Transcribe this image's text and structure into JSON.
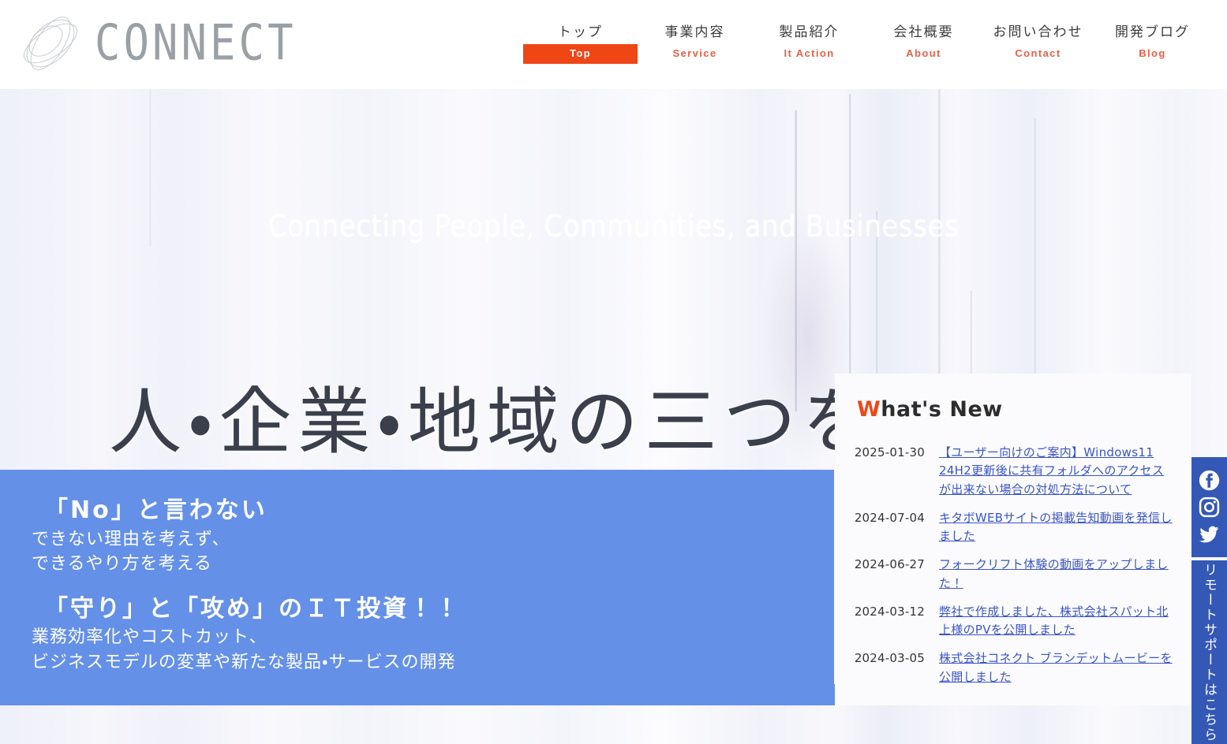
{
  "brand": {
    "name": "CONNECT",
    "logo_icon": "orbital-ellipses-logo-icon"
  },
  "nav": {
    "items": [
      {
        "ja": "トップ",
        "en": "Top",
        "active": true
      },
      {
        "ja": "事業内容",
        "en": "Service",
        "active": false
      },
      {
        "ja": "製品紹介",
        "en": "It Action",
        "active": false
      },
      {
        "ja": "会社概要",
        "en": "About",
        "active": false
      },
      {
        "ja": "お問い合わせ",
        "en": "Contact",
        "active": false
      },
      {
        "ja": "開発ブログ",
        "en": "Blog",
        "active": false
      }
    ]
  },
  "hero": {
    "tagline": "Connecting People, Communities, and Businesses",
    "headline": "人・企業・地域の三つをツナグ"
  },
  "promo": {
    "block1": {
      "heading": "「No」と言わない",
      "line1": "できない理由を考えず、",
      "line2": "できるやり方を考える"
    },
    "block2": {
      "heading": "「守り」と「攻め」のＩＴ投資！！",
      "line1": "業務効率化やコストカット、",
      "line2": "ビジネスモデルの変革や新たな製品・サービスの開発"
    }
  },
  "news": {
    "title_first_letter": "W",
    "title_rest": "hat's New",
    "items": [
      {
        "date": "2025-01-30",
        "text": "【ユーザー向けのご案内】Windows11 24H2更新後に共有フォルダへのアクセスが出来ない場合の対処方法について"
      },
      {
        "date": "2024-07-04",
        "text": "キタボWEBサイトの掲載告知動画を発信しました"
      },
      {
        "date": "2024-06-27",
        "text": "フォークリフト体験の動画をアップしました！"
      },
      {
        "date": "2024-03-12",
        "text": "弊社で作成しました、株式会社スパット北上様のPVを公開しました"
      },
      {
        "date": "2024-03-05",
        "text": "株式会社コネクト ブランデットムービーを公開しました"
      }
    ]
  },
  "sidebar": {
    "social": [
      {
        "icon": "facebook-icon"
      },
      {
        "icon": "instagram-icon"
      },
      {
        "icon": "twitter-icon"
      }
    ],
    "remote_support_label": "リモートサポートはこちら"
  },
  "colors": {
    "accent_orange": "#ef4616",
    "nav_subtitle_orange": "#e8604a",
    "promo_blue": "#6490e8",
    "sidebar_blue": "#3458b5",
    "link_blue": "#3a55c8"
  }
}
